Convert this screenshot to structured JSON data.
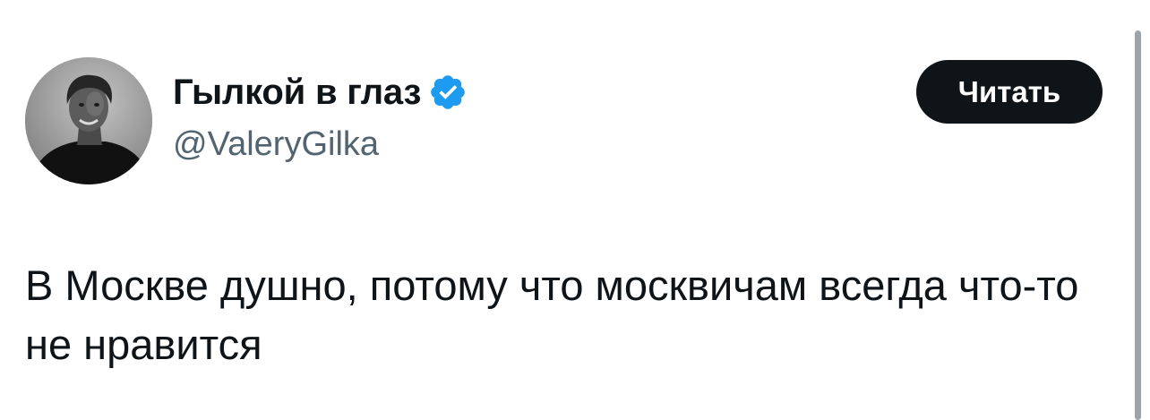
{
  "author": {
    "name": "Гылкой в глаз",
    "handle": "@ValeryGilka",
    "verified_icon": "verified-badge-icon",
    "verified_color": "#1d9bf0",
    "avatar_icon": "profile-photo"
  },
  "follow_button": {
    "label": "Читать",
    "background": "#0f1419",
    "text_color": "#ffffff"
  },
  "tweet": {
    "text": "В Москве душно, потому что москвичам всегда что-то не нравится"
  },
  "colors": {
    "background": "#ffffff",
    "primary_text": "#0f1419",
    "secondary_text": "#536471",
    "scrollbar": "#9ea3a8"
  }
}
